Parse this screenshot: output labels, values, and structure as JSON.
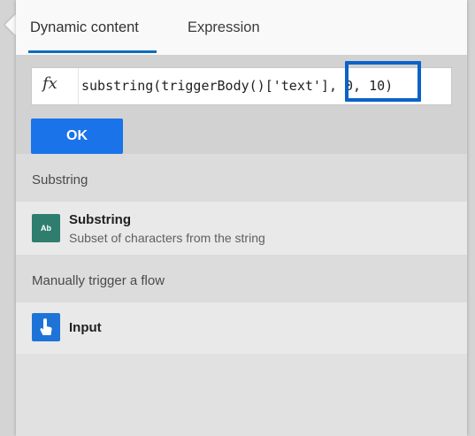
{
  "tabs": {
    "dynamic_content": "Dynamic content",
    "expression": "Expression"
  },
  "expression": {
    "value": "substring(triggerBody()['text'], 0, 10)",
    "fx_symbol": "fx"
  },
  "buttons": {
    "ok": "OK"
  },
  "sections": [
    {
      "header": "Substring",
      "items": [
        {
          "title": "Substring",
          "subtitle": "Subset of characters from the string",
          "icon": "ab-text-icon",
          "icon_text": "Ab"
        }
      ]
    },
    {
      "header": "Manually trigger a flow",
      "items": [
        {
          "title": "Input",
          "subtitle": "",
          "icon": "manual-trigger-hand-icon"
        }
      ]
    }
  ],
  "colors": {
    "accent": "#1a73e8",
    "highlight": "#0b63c8",
    "tab_underline": "#0f6cbd",
    "substring_icon": "#2e7d6f",
    "trigger_icon": "#1e73d8"
  }
}
